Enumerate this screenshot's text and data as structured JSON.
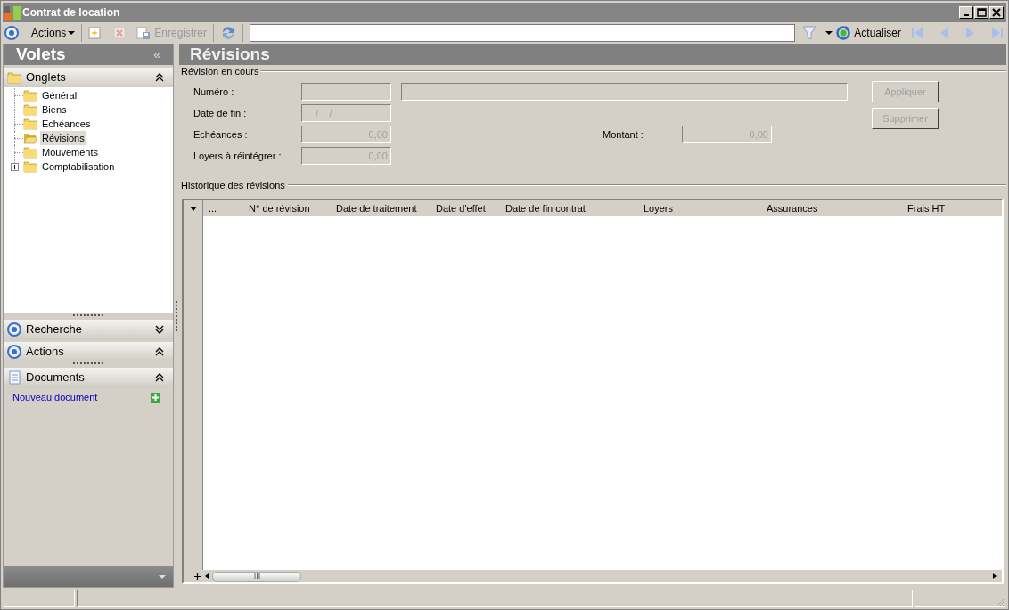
{
  "window": {
    "title": "Contrat de location"
  },
  "toolbar": {
    "actions_label": "Actions",
    "save": {
      "label": "Enregistrer",
      "disabled": true
    },
    "delete": {
      "disabled": true
    },
    "refresh_label": "Actualiser"
  },
  "sidebar": {
    "title": "Volets",
    "collapse_glyph": "«",
    "tabs_header": "Onglets",
    "tree": [
      {
        "label": "Général",
        "selected": false
      },
      {
        "label": "Biens",
        "selected": false
      },
      {
        "label": "Echéances",
        "selected": false
      },
      {
        "label": "Révisions",
        "selected": true
      },
      {
        "label": "Mouvements",
        "selected": false
      },
      {
        "label": "Comptabilisation",
        "selected": false,
        "expanded": false
      }
    ],
    "panels": [
      {
        "title": "Recherche",
        "kind": "circle",
        "expanded": false
      },
      {
        "title": "Actions",
        "kind": "circle",
        "expanded": true
      },
      {
        "title": "Documents",
        "kind": "document",
        "expanded": true,
        "link": "Nouveau document"
      }
    ]
  },
  "main": {
    "title": "Révisions",
    "current_group": "Révision en cours",
    "fields": {
      "numero": {
        "label": "Numéro :"
      },
      "date_fin": {
        "label": "Date de fin :",
        "value": "__/__/____"
      },
      "echeances": {
        "label": "Echéances :",
        "value": "0,00"
      },
      "loyers": {
        "label": "Loyers à réintégrer :",
        "value": "0,00"
      },
      "montant": {
        "label": "Montant :",
        "value": "0,00"
      }
    },
    "buttons": [
      {
        "label": "Appliquer",
        "disabled": true
      },
      {
        "label": "Supprimer",
        "disabled": true
      }
    ],
    "history_group": "Historique des révisions",
    "table": {
      "columns": [
        "...",
        "N° de révision",
        "Date de traitement",
        "Date d'effet",
        "Date de fin contrat",
        "Loyers",
        "Assurances",
        "Frais HT"
      ]
    }
  }
}
